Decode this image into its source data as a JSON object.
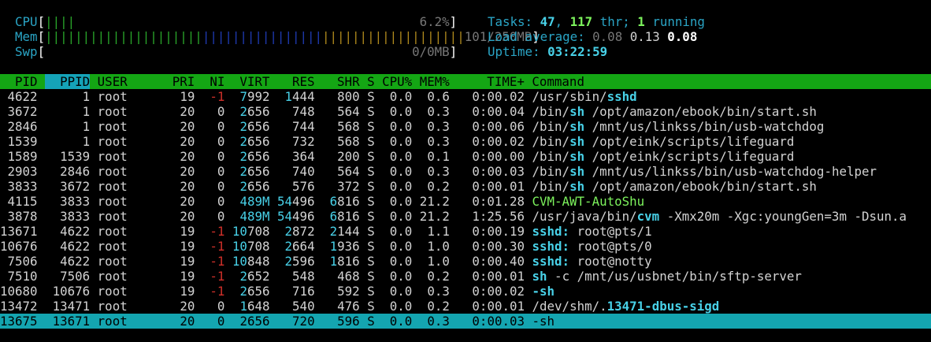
{
  "meters": {
    "cpu": {
      "label": "CPU",
      "bars": "||||",
      "value": "6.2%"
    },
    "mem": {
      "label": "Mem",
      "bars_green": "|||||||||||||||||||||",
      "bars_blue": "||||||||||||||||",
      "bars_yellow": "|||||||||||||||||||",
      "value": "101/250MB"
    },
    "swp": {
      "label": "Swp",
      "value": "0/0MB"
    }
  },
  "stats": {
    "tasks_label": "Tasks:",
    "tasks": "47",
    "threads": "117",
    "thr_label": "thr;",
    "running": "1",
    "running_label": "running",
    "load_label": "Load average:",
    "load1": "0.08",
    "load5": "0.13",
    "load15": "0.08",
    "uptime_label": "Uptime:",
    "uptime": "03:22:59"
  },
  "columns": {
    "pid": "PID",
    "ppid": "PPID",
    "user": "USER",
    "pri": "PRI",
    "ni": "NI",
    "virt": "VIRT",
    "res": "RES",
    "shr": "SHR",
    "s": "S",
    "cpu": "CPU%",
    "mem": "MEM%",
    "time": "TIME+",
    "command": "Command"
  },
  "processes": [
    {
      "pid": "4622",
      "ppid": "1",
      "user": "root",
      "pri": "19",
      "ni": "-1",
      "virt": "7992",
      "res": "1444",
      "shr": "800",
      "s": "S",
      "cpu": "0.0",
      "mem": "0.6",
      "time": "0:00.02",
      "cmd_path": "/usr/sbin/",
      "cmd_bin": "sshd",
      "cmd_args": ""
    },
    {
      "pid": "3672",
      "ppid": "1",
      "user": "root",
      "pri": "20",
      "ni": "0",
      "virt": "2656",
      "res": "748",
      "shr": "564",
      "s": "S",
      "cpu": "0.0",
      "mem": "0.3",
      "time": "0:00.04",
      "cmd_path": "/bin/",
      "cmd_bin": "sh",
      "cmd_args": " /opt/amazon/ebook/bin/start.sh"
    },
    {
      "pid": "2846",
      "ppid": "1",
      "user": "root",
      "pri": "20",
      "ni": "0",
      "virt": "2656",
      "res": "744",
      "shr": "568",
      "s": "S",
      "cpu": "0.0",
      "mem": "0.3",
      "time": "0:00.06",
      "cmd_path": "/bin/",
      "cmd_bin": "sh",
      "cmd_args": " /mnt/us/linkss/bin/usb-watchdog"
    },
    {
      "pid": "1539",
      "ppid": "1",
      "user": "root",
      "pri": "20",
      "ni": "0",
      "virt": "2656",
      "res": "732",
      "shr": "568",
      "s": "S",
      "cpu": "0.0",
      "mem": "0.3",
      "time": "0:00.02",
      "cmd_path": "/bin/",
      "cmd_bin": "sh",
      "cmd_args": " /opt/eink/scripts/lifeguard"
    },
    {
      "pid": "1589",
      "ppid": "1539",
      "user": "root",
      "pri": "20",
      "ni": "0",
      "virt": "2656",
      "res": "364",
      "shr": "200",
      "s": "S",
      "cpu": "0.0",
      "mem": "0.1",
      "time": "0:00.00",
      "cmd_path": "/bin/",
      "cmd_bin": "sh",
      "cmd_args": " /opt/eink/scripts/lifeguard"
    },
    {
      "pid": "2903",
      "ppid": "2846",
      "user": "root",
      "pri": "20",
      "ni": "0",
      "virt": "2656",
      "res": "740",
      "shr": "564",
      "s": "S",
      "cpu": "0.0",
      "mem": "0.3",
      "time": "0:00.03",
      "cmd_path": "/bin/",
      "cmd_bin": "sh",
      "cmd_args": " /mnt/us/linkss/bin/usb-watchdog-helper"
    },
    {
      "pid": "3833",
      "ppid": "3672",
      "user": "root",
      "pri": "20",
      "ni": "0",
      "virt": "2656",
      "res": "576",
      "shr": "372",
      "s": "S",
      "cpu": "0.0",
      "mem": "0.2",
      "time": "0:00.01",
      "cmd_path": "/bin/",
      "cmd_bin": "sh",
      "cmd_args": " /opt/amazon/ebook/bin/start.sh"
    },
    {
      "pid": "4115",
      "ppid": "3833",
      "user": "root",
      "pri": "20",
      "ni": "0",
      "virt": "489M",
      "res": "54496",
      "shr": "6816",
      "s": "S",
      "cpu": "0.0",
      "mem": "21.2",
      "time": "0:01.28",
      "cmd_path": "",
      "cmd_bin": "",
      "cmd_thread": "CVM-AWT-AutoShu",
      "cmd_args": ""
    },
    {
      "pid": "3878",
      "ppid": "3833",
      "user": "root",
      "pri": "20",
      "ni": "0",
      "virt": "489M",
      "res": "54496",
      "shr": "6816",
      "s": "S",
      "cpu": "0.0",
      "mem": "21.2",
      "time": "1:25.56",
      "cmd_path": "/usr/java/bin/",
      "cmd_bin": "cvm",
      "cmd_args": " -Xmx20m -Xgc:youngGen=3m -Dsun.a"
    },
    {
      "pid": "13671",
      "ppid": "4622",
      "user": "root",
      "pri": "19",
      "ni": "-1",
      "virt": "10708",
      "res": "2872",
      "shr": "2144",
      "s": "S",
      "cpu": "0.0",
      "mem": "1.1",
      "time": "0:00.19",
      "cmd_path": "",
      "cmd_bin": "sshd:",
      "cmd_args": " root@pts/1"
    },
    {
      "pid": "10676",
      "ppid": "4622",
      "user": "root",
      "pri": "19",
      "ni": "-1",
      "virt": "10708",
      "res": "2664",
      "shr": "1936",
      "s": "S",
      "cpu": "0.0",
      "mem": "1.0",
      "time": "0:00.30",
      "cmd_path": "",
      "cmd_bin": "sshd:",
      "cmd_args": " root@pts/0"
    },
    {
      "pid": "7506",
      "ppid": "4622",
      "user": "root",
      "pri": "19",
      "ni": "-1",
      "virt": "10848",
      "res": "2596",
      "shr": "1816",
      "s": "S",
      "cpu": "0.0",
      "mem": "1.0",
      "time": "0:00.40",
      "cmd_path": "",
      "cmd_bin": "sshd:",
      "cmd_args": " root@notty"
    },
    {
      "pid": "7510",
      "ppid": "7506",
      "user": "root",
      "pri": "19",
      "ni": "-1",
      "virt": "2652",
      "res": "548",
      "shr": "468",
      "s": "S",
      "cpu": "0.0",
      "mem": "0.2",
      "time": "0:00.01",
      "cmd_path": "",
      "cmd_bin": "sh",
      "cmd_args": " -c /mnt/us/usbnet/bin/sftp-server"
    },
    {
      "pid": "10680",
      "ppid": "10676",
      "user": "root",
      "pri": "19",
      "ni": "-1",
      "virt": "2656",
      "res": "716",
      "shr": "592",
      "s": "S",
      "cpu": "0.0",
      "mem": "0.3",
      "time": "0:00.02",
      "cmd_path": "",
      "cmd_bin": "-sh",
      "cmd_args": ""
    },
    {
      "pid": "13472",
      "ppid": "13471",
      "user": "root",
      "pri": "20",
      "ni": "0",
      "virt": "1648",
      "res": "540",
      "shr": "476",
      "s": "S",
      "cpu": "0.0",
      "mem": "0.2",
      "time": "0:00.01",
      "cmd_path": "/dev/shm/.",
      "cmd_bin": "13471-dbus-sigd",
      "cmd_args": ""
    },
    {
      "pid": "13675",
      "ppid": "13671",
      "user": "root",
      "pri": "20",
      "ni": "0",
      "virt": "2656",
      "res": "720",
      "shr": "596",
      "s": "S",
      "cpu": "0.0",
      "mem": "0.3",
      "time": "0:00.03",
      "cmd_path": "",
      "cmd_bin": "-sh",
      "cmd_args": "",
      "selected": true
    }
  ]
}
